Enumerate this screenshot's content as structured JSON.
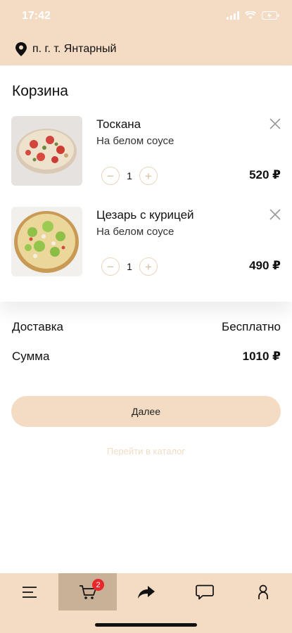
{
  "status": {
    "time": "17:42"
  },
  "location": {
    "text": "п. г. т. Янтарный",
    "icon": "map-pin-icon"
  },
  "cart": {
    "title": "Корзина",
    "items": [
      {
        "name": "Тоскана",
        "description": "На белом соусе",
        "quantity": "1",
        "price": "520 ₽",
        "image": "pizza-toscana"
      },
      {
        "name": "Цезарь с курицей",
        "description": "На белом соусе",
        "quantity": "1",
        "price": "490 ₽",
        "image": "pizza-caesar"
      }
    ]
  },
  "summary": {
    "delivery_label": "Доставка",
    "delivery_value": "Бесплатно",
    "total_label": "Сумма",
    "total_value": "1010 ₽"
  },
  "actions": {
    "next_label": "Далее",
    "catalog_label": "Перейти в каталог"
  },
  "tabbar": {
    "items": [
      {
        "icon": "menu-icon"
      },
      {
        "icon": "cart-icon",
        "badge": "2",
        "active": true
      },
      {
        "icon": "share-icon"
      },
      {
        "icon": "chat-icon"
      },
      {
        "icon": "profile-icon"
      }
    ]
  },
  "colors": {
    "accent": "#f3dcc3",
    "active_tab": "#c9b197",
    "badge": "#e8262c"
  }
}
